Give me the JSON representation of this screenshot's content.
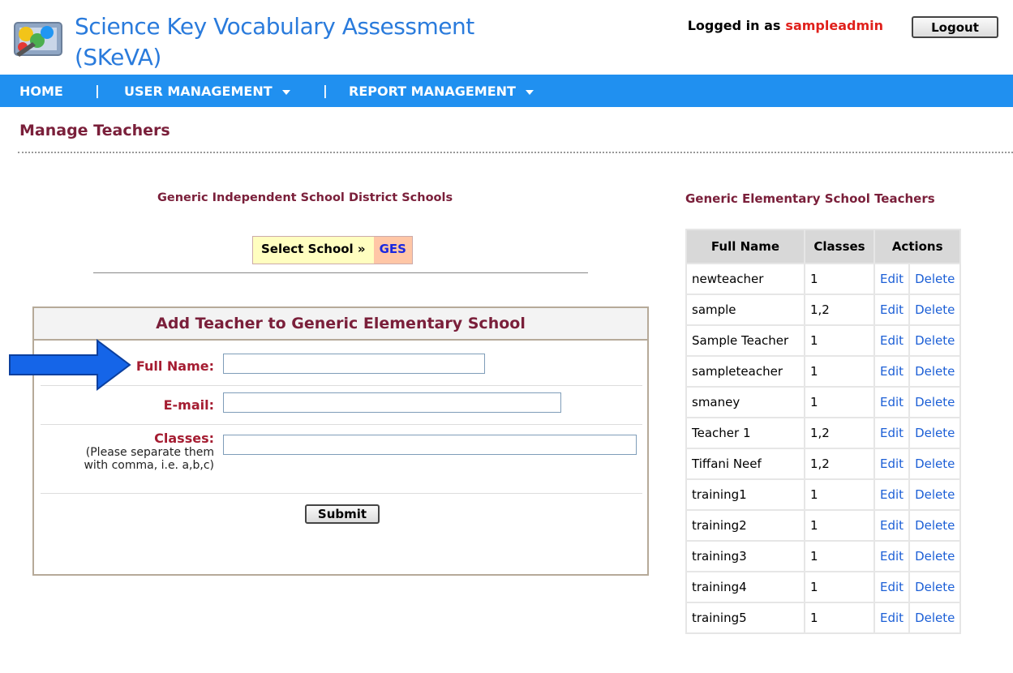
{
  "header": {
    "app_title": "Science Key Vocabulary Assessment (SKeVA)",
    "logged_in_as_label": "Logged in as",
    "username": "sampleadmin",
    "logout_label": "Logout"
  },
  "nav": {
    "home": "HOME",
    "separator": "|",
    "user_management": "USER MANAGEMENT",
    "report_management": "REPORT MANAGEMENT"
  },
  "page_title": "Manage Teachers",
  "district": {
    "heading": "Generic Independent School District Schools",
    "select_label": "Select School »",
    "selected_school": "GES"
  },
  "add_form": {
    "title": "Add Teacher to Generic Elementary School",
    "full_name_label": "Full Name:",
    "email_label": "E-mail:",
    "classes_label": "Classes:",
    "classes_hint_line1": "(Please separate them",
    "classes_hint_line2": "with comma, i.e. a,b,c)",
    "submit_label": "Submit",
    "full_name_value": "",
    "email_value": "",
    "classes_value": ""
  },
  "teachers": {
    "heading": "Generic Elementary School Teachers",
    "columns": {
      "name": "Full Name",
      "classes": "Classes",
      "actions": "Actions"
    },
    "edit_label": "Edit",
    "delete_label": "Delete",
    "rows": [
      {
        "name": "newteacher",
        "classes": "1"
      },
      {
        "name": "sample",
        "classes": "1,2"
      },
      {
        "name": "Sample Teacher",
        "classes": "1"
      },
      {
        "name": "sampleteacher",
        "classes": "1"
      },
      {
        "name": "smaney",
        "classes": "1"
      },
      {
        "name": "Teacher 1",
        "classes": "1,2"
      },
      {
        "name": "Tiffani Neef",
        "classes": "1,2"
      },
      {
        "name": "training1",
        "classes": "1"
      },
      {
        "name": "training2",
        "classes": "1"
      },
      {
        "name": "training3",
        "classes": "1"
      },
      {
        "name": "training4",
        "classes": "1"
      },
      {
        "name": "training5",
        "classes": "1"
      }
    ]
  },
  "colors": {
    "nav_bg": "#2090f0",
    "title_blue": "#2a7bdc",
    "heading_maroon": "#7a1f3a",
    "username_red": "#e0201b",
    "link_blue": "#1c5fd6",
    "arrow_blue": "#1565e8"
  }
}
